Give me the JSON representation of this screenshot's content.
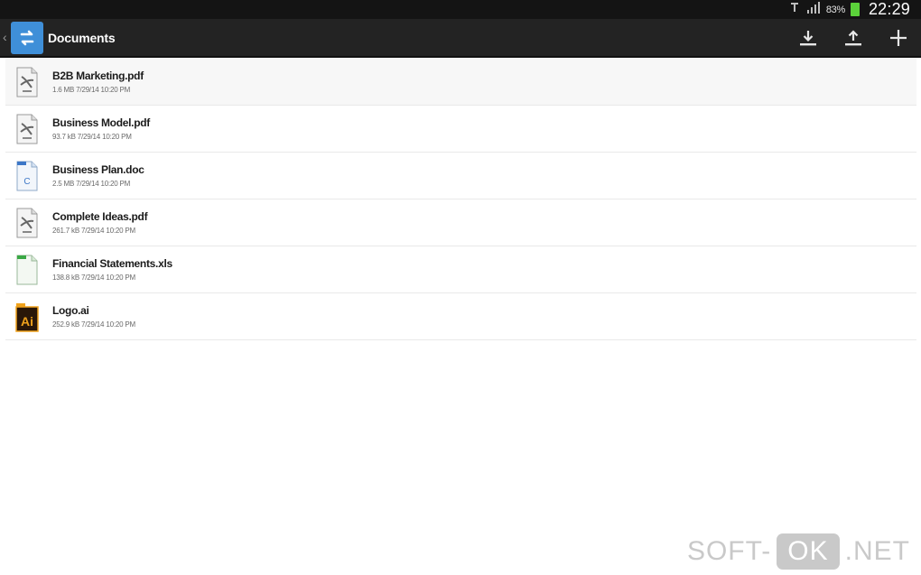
{
  "status_bar": {
    "battery_text": "83%",
    "time": "22:29",
    "battery_color": "#5bd23a"
  },
  "action_bar": {
    "title": "Documents",
    "app_icon_color": "#3f8fd8"
  },
  "files": [
    {
      "name": "B2B Marketing.pdf",
      "meta": "1.6 MB 7/29/14 10:20 PM",
      "icon": "pdf-file-icon"
    },
    {
      "name": "Business Model.pdf",
      "meta": "93.7 kB 7/29/14 10:20 PM",
      "icon": "pdf-file-icon"
    },
    {
      "name": "Business Plan.doc",
      "meta": "2.5 MB 7/29/14 10:20 PM",
      "icon": "doc-file-icon"
    },
    {
      "name": "Complete Ideas.pdf",
      "meta": "261.7 kB 7/29/14 10:20 PM",
      "icon": "pdf-file-icon"
    },
    {
      "name": "Financial Statements.xls",
      "meta": "138.8 kB 7/29/14 10:20 PM",
      "icon": "xls-file-icon"
    },
    {
      "name": "Logo.ai",
      "meta": "252.9 kB 7/29/14 10:20 PM",
      "icon": "ai-file-icon"
    }
  ],
  "watermark": {
    "left": "SOFT-",
    "box": "OK",
    "right": ".NET"
  }
}
